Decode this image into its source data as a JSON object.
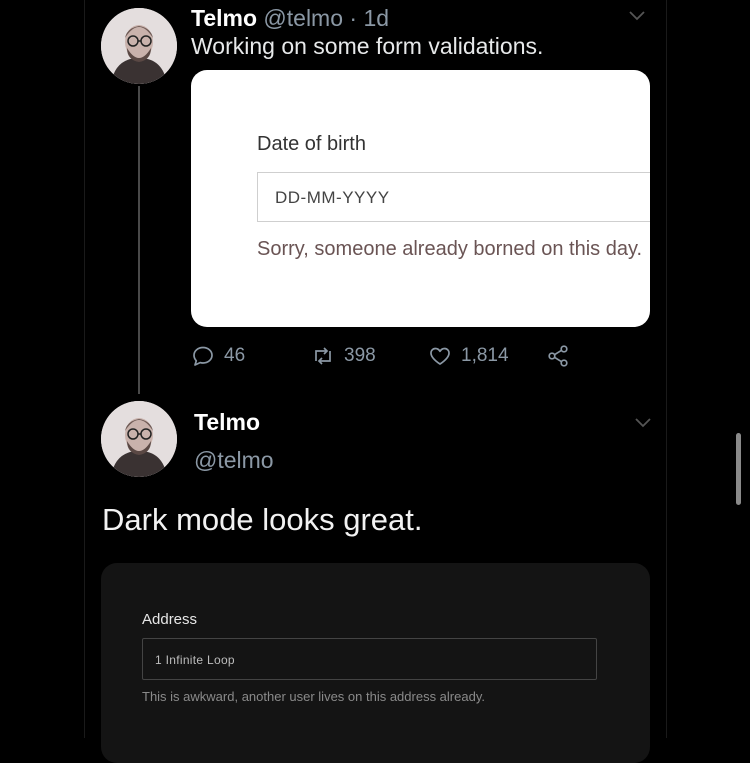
{
  "tweet1": {
    "name": "Telmo",
    "handle": "@telmo",
    "separator": "·",
    "time": "1d",
    "text": "Working on some form validations.",
    "card": {
      "label": "Date of birth",
      "input_value": "DD-MM-YYYY",
      "error": "Sorry, someone already borned on this day."
    },
    "actions": {
      "replies": "46",
      "retweets": "398",
      "likes": "1,814"
    }
  },
  "tweet2": {
    "name": "Telmo",
    "handle": "@telmo",
    "text": "Dark mode looks great.",
    "card": {
      "label": "Address",
      "input_value": "1 Infinite Loop",
      "error": "This is awkward, another user lives on this address already."
    }
  },
  "icons": {
    "reply": "reply-icon",
    "retweet": "retweet-icon",
    "like": "heart-icon",
    "share": "share-icon",
    "more": "chevron-down-icon"
  },
  "colors": {
    "background": "#000000",
    "text": "#e7e9ea",
    "muted": "#8b98a5",
    "card_light": "#ffffff",
    "card_dark": "#141414"
  }
}
